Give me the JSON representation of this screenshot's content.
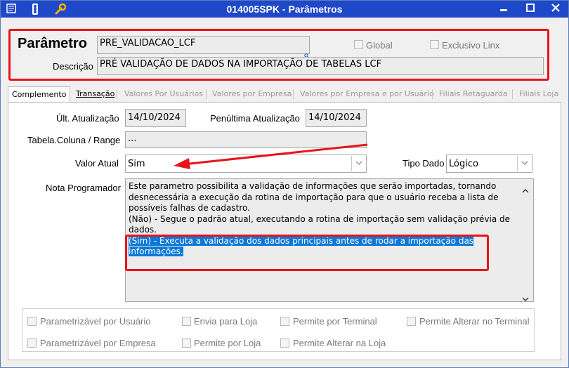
{
  "window": {
    "title": "014005SPK - Parâmetros",
    "minimize_glyph": "▬",
    "maximize_glyph": "□",
    "close_glyph": "✕",
    "toolbar_icons": [
      "list-icon",
      "traffic-light-icon",
      "wrench-icon"
    ]
  },
  "header": {
    "parametro_label": "Parâmetro",
    "parametro_value": "PRE_VALIDACAO_LCF",
    "descricao_label": "Descrição",
    "descricao_value": "PRÉ VALIDAÇÃO DE DADOS NA IMPORTAÇÃO DE TABELAS LCF",
    "global_label": "Global",
    "exclusivo_label": "Exclusivo Linx"
  },
  "tabs": [
    {
      "label": "Complemento"
    },
    {
      "label": "Transação"
    },
    {
      "label": "Valores Por Usuários"
    },
    {
      "label": "Valores por Empresa"
    },
    {
      "label": "Valores por Empresa e por Usuário"
    },
    {
      "label": "Filiais Retaguarda"
    },
    {
      "label": "Filiais Loja"
    }
  ],
  "form": {
    "ult_atualizacao_label": "Últ. Atualização",
    "ult_atualizacao_value": "14/10/2024",
    "penultima_label": "Penúltima Atualização",
    "penultima_value": "14/10/2024",
    "tabela_label": "Tabela.Coluna / Range",
    "tabela_value": "...",
    "valor_atual_label": "Valor Atual",
    "valor_atual_value": "Sim",
    "tipo_dado_label": "Tipo Dado",
    "tipo_dado_value": "Lógico",
    "nota_label": "Nota Programador",
    "nota_lines": [
      "Este parametro possibilita a validação de informações que serão importadas, tornando",
      "desnecessária a execução da rotina de importação para que o usuário receba a lista de",
      "possíveis falhas de cadastro.",
      "(Não) - Segue o padrão atual, executando a rotina de importação sem validação prévia de",
      "dados."
    ],
    "nota_highlight_lines": [
      "(Sim) - Executa a validação dos dados principais antes de rodar a importação das",
      "informações."
    ],
    "scroll_up": "˄",
    "scroll_down": "˅"
  },
  "options": {
    "row1": [
      "Parametrizável por Usuário",
      "Envia para Loja",
      "Permite por Terminal",
      "Permite Alterar no Terminal"
    ],
    "row2": [
      "Parametrizável por Empresa",
      "Permite por Loja",
      "Permite Alterar na Loja"
    ]
  },
  "colors": {
    "titlebar": "#1f48c9",
    "annotation_red": "#e8141a",
    "selection": "#0a78d7"
  }
}
